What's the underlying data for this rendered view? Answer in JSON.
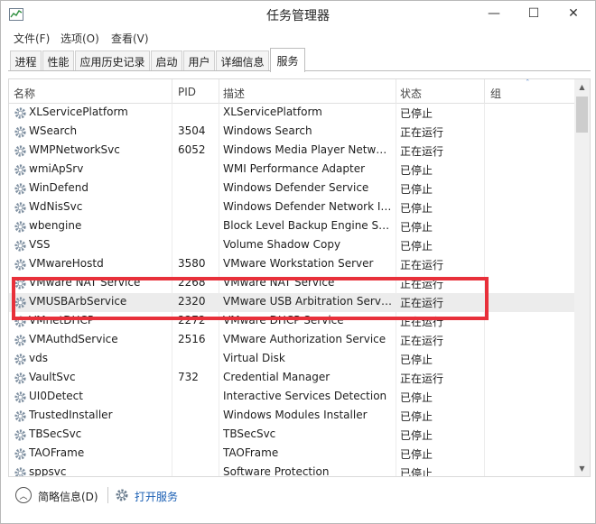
{
  "window": {
    "title": "任务管理器",
    "minimize_glyph": "—",
    "maximize_glyph": "☐",
    "close_glyph": "✕"
  },
  "menu": [
    {
      "label": "文件(F)"
    },
    {
      "label": "选项(O)"
    },
    {
      "label": "查看(V)"
    }
  ],
  "tabs": [
    {
      "label": "进程",
      "active": false
    },
    {
      "label": "性能",
      "active": false
    },
    {
      "label": "应用历史记录",
      "active": false
    },
    {
      "label": "启动",
      "active": false
    },
    {
      "label": "用户",
      "active": false
    },
    {
      "label": "详细信息",
      "active": false
    },
    {
      "label": "服务",
      "active": true
    }
  ],
  "table": {
    "columns": {
      "name": "名称",
      "pid": "PID",
      "desc": "描述",
      "status": "状态",
      "group": "组"
    },
    "sort_glyph": "ˆ",
    "selected_row": 10,
    "rows": [
      {
        "name": "XLServicePlatform",
        "pid": "",
        "desc": "XLServicePlatform",
        "status": "已停止"
      },
      {
        "name": "WSearch",
        "pid": "3504",
        "desc": "Windows Search",
        "status": "正在运行"
      },
      {
        "name": "WMPNetworkSvc",
        "pid": "6052",
        "desc": "Windows Media Player Netw…",
        "status": "正在运行"
      },
      {
        "name": "wmiApSrv",
        "pid": "",
        "desc": "WMI Performance Adapter",
        "status": "已停止"
      },
      {
        "name": "WinDefend",
        "pid": "",
        "desc": "Windows Defender Service",
        "status": "已停止"
      },
      {
        "name": "WdNisSvc",
        "pid": "",
        "desc": "Windows Defender Network I…",
        "status": "已停止"
      },
      {
        "name": "wbengine",
        "pid": "",
        "desc": "Block Level Backup Engine Se…",
        "status": "已停止"
      },
      {
        "name": "VSS",
        "pid": "",
        "desc": "Volume Shadow Copy",
        "status": "已停止"
      },
      {
        "name": "VMwareHostd",
        "pid": "3580",
        "desc": "VMware Workstation Server",
        "status": "正在运行"
      },
      {
        "name": "VMware NAT Service",
        "pid": "2268",
        "desc": "VMware NAT Service",
        "status": "正在运行"
      },
      {
        "name": "VMUSBArbService",
        "pid": "2320",
        "desc": "VMware USB Arbitration Serv…",
        "status": "正在运行"
      },
      {
        "name": "VMnetDHCP",
        "pid": "2272",
        "desc": "VMware DHCP Service",
        "status": "正在运行"
      },
      {
        "name": "VMAuthdService",
        "pid": "2516",
        "desc": "VMware Authorization Service",
        "status": "正在运行"
      },
      {
        "name": "vds",
        "pid": "",
        "desc": "Virtual Disk",
        "status": "已停止"
      },
      {
        "name": "VaultSvc",
        "pid": "732",
        "desc": "Credential Manager",
        "status": "正在运行"
      },
      {
        "name": "UI0Detect",
        "pid": "",
        "desc": "Interactive Services Detection",
        "status": "已停止"
      },
      {
        "name": "TrustedInstaller",
        "pid": "",
        "desc": "Windows Modules Installer",
        "status": "已停止"
      },
      {
        "name": "TBSecSvc",
        "pid": "",
        "desc": "TBSecSvc",
        "status": "已停止"
      },
      {
        "name": "TAOFrame",
        "pid": "",
        "desc": "TAOFrame",
        "status": "已停止"
      },
      {
        "name": "sppsvc",
        "pid": "",
        "desc": "Software Protection",
        "status": "已停止"
      }
    ]
  },
  "footer": {
    "fewer_details": "简略信息(D)",
    "fewer_glyph": "︿",
    "open_services": "打开服务"
  },
  "colors": {
    "highlight": "#e8303a",
    "link": "#1a5fb4"
  }
}
